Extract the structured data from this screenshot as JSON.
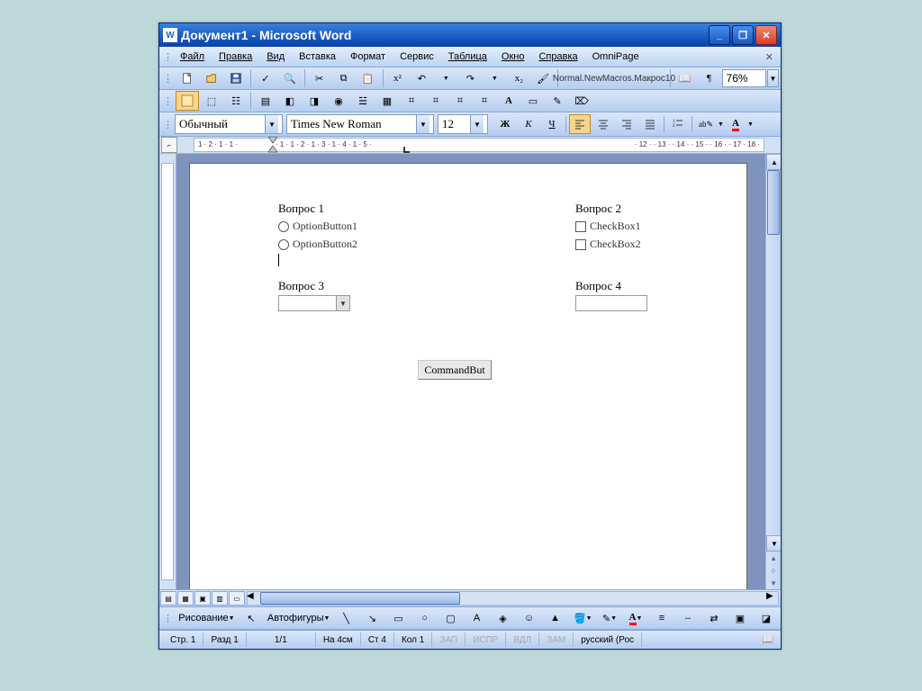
{
  "title": "Документ1 - Microsoft Word",
  "menu": {
    "file": "Файл",
    "edit": "Правка",
    "view": "Вид",
    "insert": "Вставка",
    "format": "Формат",
    "tools": "Сервис",
    "table": "Таблица",
    "window": "Окно",
    "help": "Справка",
    "omni": "OmniPage"
  },
  "std_toolbar": {
    "macro_name": "Normal.NewMacros.Макрос10",
    "zoom": "76%"
  },
  "fmt": {
    "style": "Обычный",
    "font": "Times New Roman",
    "size": "12",
    "bold": "Ж",
    "italic": "К",
    "underline": "Ч"
  },
  "ruler": {
    "nums_left": "1 · 2 · 1 · 1 ·",
    "nums_mid": "· 1 · 1 · 2 · 1 · 3 · 1 · 4 · 1 · 5 ·",
    "nums_right": "· 12 · · 13 · · 14 · · 15 · · 16 · · 17 · 18 ·"
  },
  "doc": {
    "q1": "Вопрос 1",
    "q2": "Вопрос 2",
    "q3": "Вопрос 3",
    "q4": "Вопрос 4",
    "opt1": "OptionButton1",
    "opt2": "OptionButton2",
    "chk1": "CheckBox1",
    "chk2": "CheckBox2",
    "cmd": "CommandBut"
  },
  "draw": {
    "draw_label": "Рисование",
    "autoshapes": "Автофигуры"
  },
  "status": {
    "page": "Стр. 1",
    "section": "Разд 1",
    "pages": "1/1",
    "at": "На 4см",
    "line": "Ст 4",
    "col": "Кол 1",
    "rec": "ЗАП",
    "trk": "ИСПР",
    "ext": "ВДЛ",
    "ovr": "ЗАМ",
    "lang": "русский (Рос"
  }
}
